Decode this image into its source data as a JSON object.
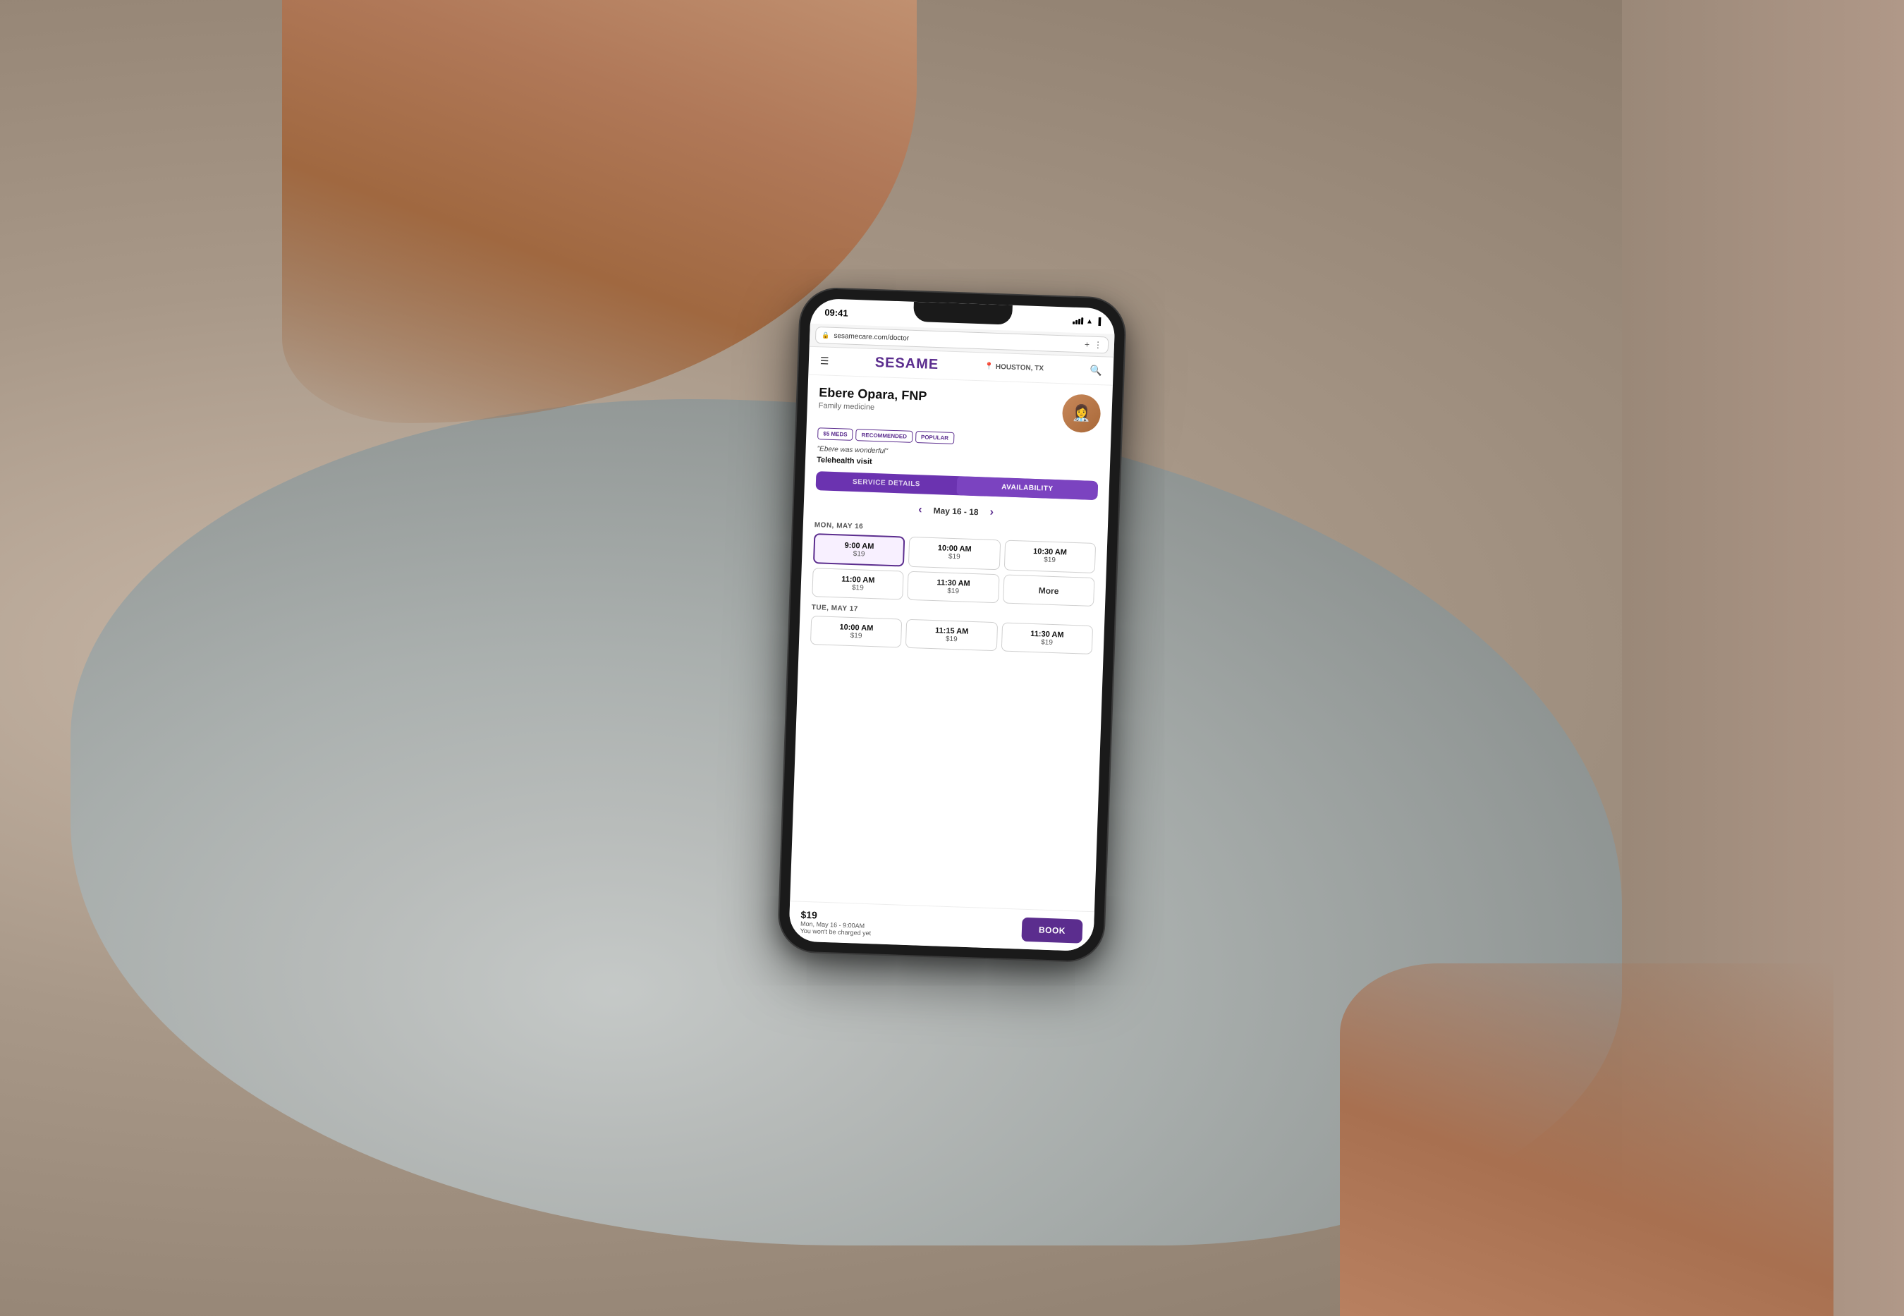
{
  "background": {
    "base_color": "#b8a898"
  },
  "status_bar": {
    "time": "09:41",
    "signal": "●●●",
    "wifi": "WiFi",
    "battery": "Battery"
  },
  "browser": {
    "url": "sesamecare.com/doctor",
    "add_tab_label": "+",
    "menu_label": "⋮"
  },
  "navbar": {
    "logo": "SESAME",
    "location": "HOUSTON, TX",
    "menu_icon": "☰",
    "search_icon": "🔍"
  },
  "doctor": {
    "name": "Ebere Opara, FNP",
    "specialty": "Family medicine",
    "badges": [
      "$5 MEDS",
      "RECOMMENDED",
      "POPULAR"
    ],
    "quote": "\"Ebere was wonderful\"",
    "visit_type": "Telehealth visit",
    "avatar_emoji": "👩‍⚕️"
  },
  "tabs": {
    "service_details": "SERVICE DETAILS",
    "availability": "AVAILABILITY"
  },
  "date_nav": {
    "range": "May 16 - 18",
    "left_arrow": "‹",
    "right_arrow": "›"
  },
  "schedule": {
    "monday": {
      "label": "MON, MAY 16",
      "slots": [
        {
          "time": "9:00 AM",
          "price": "$19",
          "selected": true
        },
        {
          "time": "10:00 AM",
          "price": "$19",
          "selected": false
        },
        {
          "time": "10:30 AM",
          "price": "$19",
          "selected": false
        },
        {
          "time": "11:00 AM",
          "price": "$19",
          "selected": false
        },
        {
          "time": "11:30 AM",
          "price": "$19",
          "selected": false
        },
        {
          "time": "More",
          "price": "",
          "selected": false,
          "is_more": true
        }
      ]
    },
    "tuesday": {
      "label": "TUE, MAY 17",
      "slots": [
        {
          "time": "10:00 AM",
          "price": "$19",
          "selected": false
        },
        {
          "time": "11:15 AM",
          "price": "$19",
          "selected": false
        },
        {
          "time": "11:30 AM",
          "price": "$19",
          "selected": false
        }
      ]
    }
  },
  "booking": {
    "price": "$19",
    "date_time": "Mon, May 16 - 9:00AM",
    "note": "You won't be charged yet",
    "book_label": "BOOK"
  },
  "colors": {
    "brand_purple": "#5b2d8e",
    "tab_purple": "#6b33b0"
  }
}
